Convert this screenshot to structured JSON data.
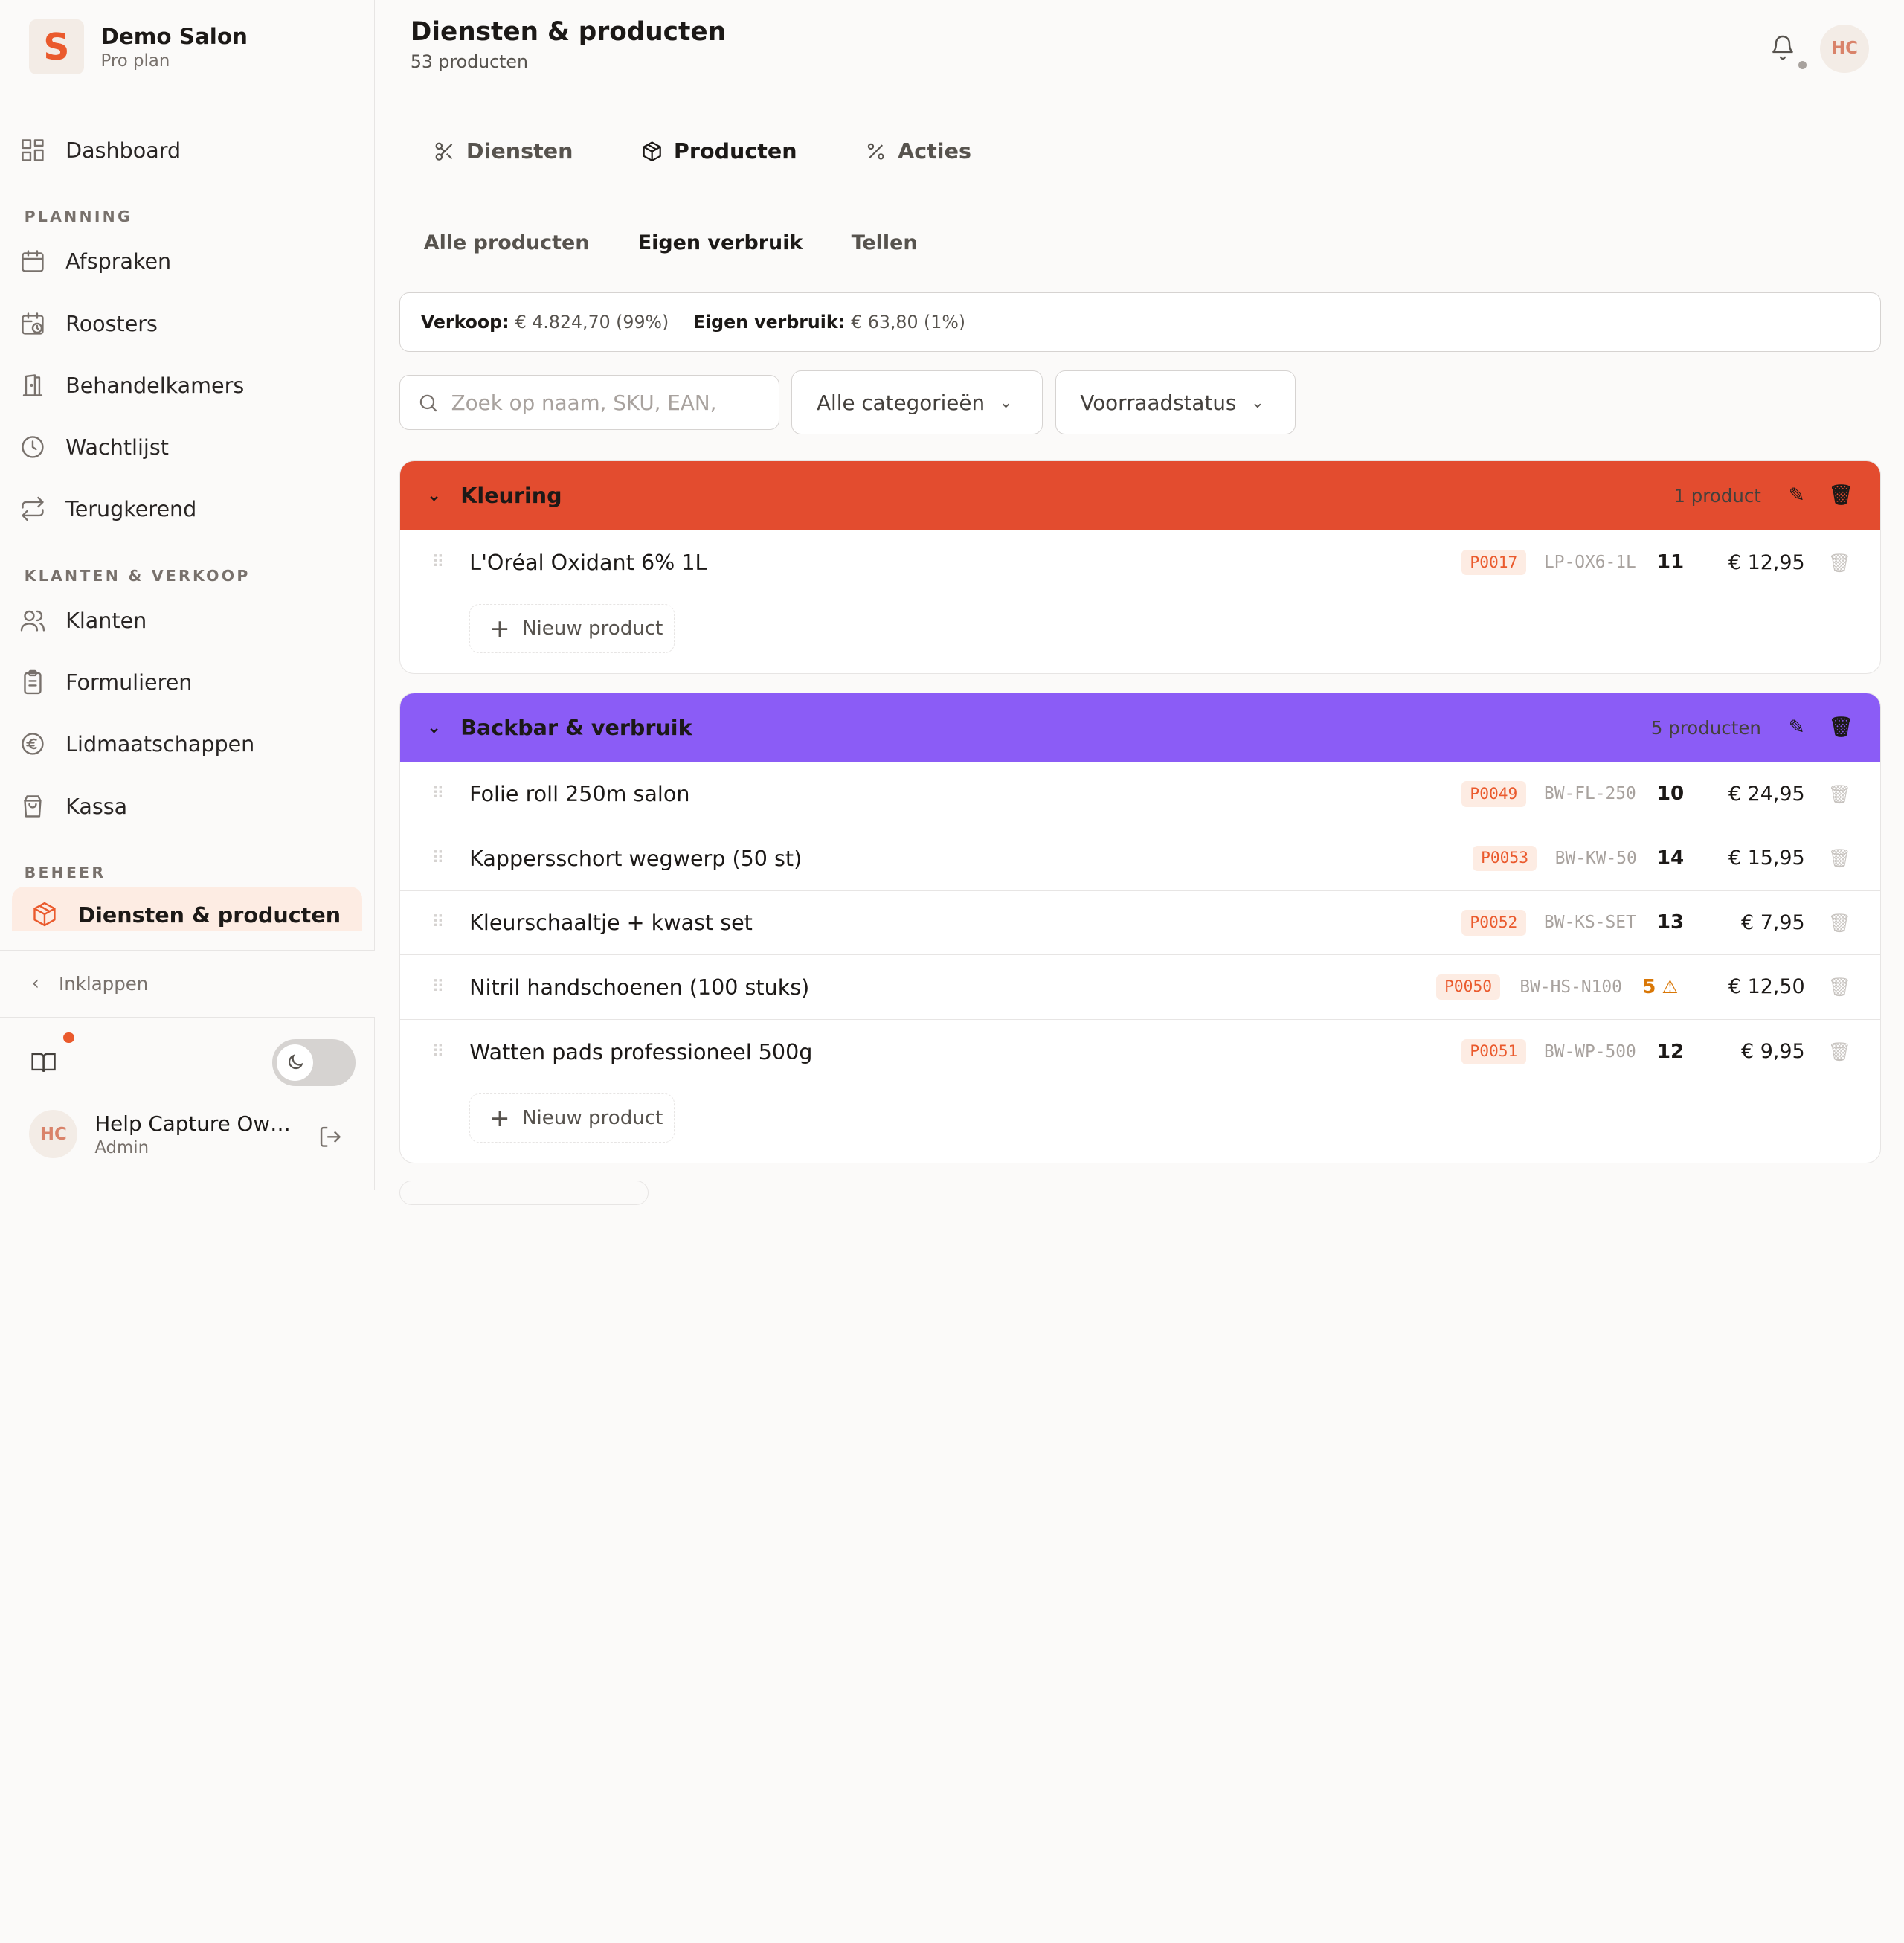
{
  "brand": {
    "name": "Demo Salon",
    "plan": "Pro plan",
    "logo_letter": "S"
  },
  "nav": {
    "dashboard": "Dashboard",
    "section_planning": "PLANNING",
    "planning": [
      "Afspraken",
      "Roosters",
      "Behandelkamers",
      "Wachtlijst",
      "Terugkerend"
    ],
    "section_klanten": "KLANTEN & VERKOOP",
    "klanten": [
      "Klanten",
      "Formulieren",
      "Lidmaatschappen",
      "Kassa"
    ],
    "section_beheer": "BEHEER",
    "active": "Diensten & producten"
  },
  "sidebar": {
    "collapse_label": "Inklappen",
    "user_initials": "HC",
    "user_name": "Help Capture Ow…",
    "user_role": "Admin"
  },
  "header": {
    "title": "Diensten & producten",
    "subtitle": "53 producten",
    "avatar": "HC"
  },
  "tabs": [
    "Diensten",
    "Producten",
    "Acties"
  ],
  "subtabs": [
    "Alle producten",
    "Eigen verbruik",
    "Tellen"
  ],
  "summary": {
    "verkoop_label": "Verkoop:",
    "verkoop_value": "€ 4.824,70 (99%)",
    "eigen_label": "Eigen verbruik:",
    "eigen_value": "€ 63,80 (1%)"
  },
  "filters": {
    "search_placeholder": "Zoek op naam, SKU, EAN,",
    "category": "Alle categorieën",
    "stock": "Voorraadstatus"
  },
  "colors": {
    "kleuring": "#e34c2f",
    "backbar": "#8b5cf6",
    "accent": "#ea5a2d"
  },
  "groups": [
    {
      "name": "Kleuring",
      "count": "1 product",
      "items": [
        {
          "name": "L'Oréal Oxidant 6% 1L",
          "code": "P0017",
          "sku": "LP-OX6-1L",
          "stock": "11",
          "price": "€ 12,95"
        }
      ],
      "new_label": "Nieuw product"
    },
    {
      "name": "Backbar & verbruik",
      "count": "5 producten",
      "items": [
        {
          "name": "Folie roll 250m salon",
          "code": "P0049",
          "sku": "BW-FL-250",
          "stock": "10",
          "price": "€ 24,95"
        },
        {
          "name": "Kappersschort wegwerp (50 st)",
          "code": "P0053",
          "sku": "BW-KW-50",
          "stock": "14",
          "price": "€ 15,95"
        },
        {
          "name": "Kleurschaaltje + kwast set",
          "code": "P0052",
          "sku": "BW-KS-SET",
          "stock": "13",
          "price": "€ 7,95"
        },
        {
          "name": "Nitril handschoenen (100 stuks)",
          "code": "P0050",
          "sku": "BW-HS-N100",
          "stock": "5",
          "price": "€ 12,50"
        },
        {
          "name": "Watten pads professioneel 500g",
          "code": "P0051",
          "sku": "BW-WP-500",
          "stock": "12",
          "price": "€ 9,95"
        }
      ],
      "new_label": "Nieuw product"
    }
  ]
}
